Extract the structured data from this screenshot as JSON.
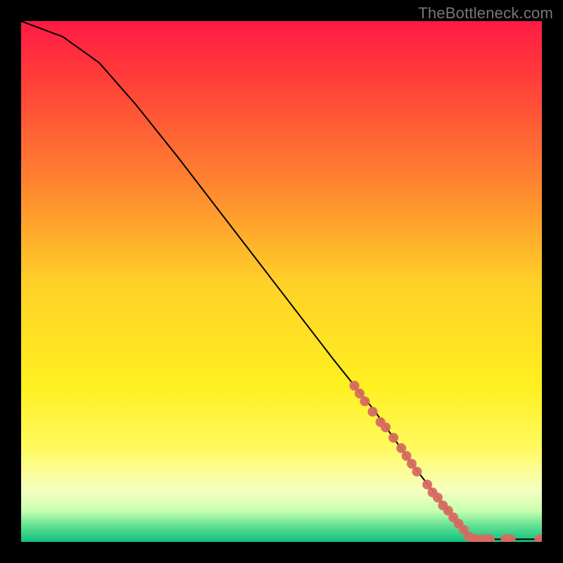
{
  "watermark": "TheBottleneck.com",
  "chart_data": {
    "type": "line",
    "title": "",
    "xlabel": "",
    "ylabel": "",
    "xlim": [
      0,
      100
    ],
    "ylim": [
      0,
      100
    ],
    "grid": false,
    "legend": false,
    "background_gradient": [
      {
        "pos": 0.0,
        "color": "#ff1a44"
      },
      {
        "pos": 0.1,
        "color": "#ff3a3a"
      },
      {
        "pos": 0.3,
        "color": "#ff8030"
      },
      {
        "pos": 0.5,
        "color": "#ffd028"
      },
      {
        "pos": 0.7,
        "color": "#fff020"
      },
      {
        "pos": 0.82,
        "color": "#fffa60"
      },
      {
        "pos": 0.9,
        "color": "#f7ffc0"
      },
      {
        "pos": 0.94,
        "color": "#c8ffb0"
      },
      {
        "pos": 0.97,
        "color": "#60e090"
      },
      {
        "pos": 1.0,
        "color": "#10c080"
      }
    ],
    "curve": [
      {
        "x": 0,
        "y": 100
      },
      {
        "x": 8,
        "y": 97
      },
      {
        "x": 15,
        "y": 92
      },
      {
        "x": 22,
        "y": 84
      },
      {
        "x": 30,
        "y": 74
      },
      {
        "x": 40,
        "y": 61
      },
      {
        "x": 50,
        "y": 48
      },
      {
        "x": 60,
        "y": 35
      },
      {
        "x": 68,
        "y": 25
      },
      {
        "x": 75,
        "y": 15
      },
      {
        "x": 82,
        "y": 6
      },
      {
        "x": 86,
        "y": 1
      },
      {
        "x": 90,
        "y": 0.5
      },
      {
        "x": 100,
        "y": 0.5
      }
    ],
    "points": [
      {
        "x": 64,
        "y": 30
      },
      {
        "x": 65,
        "y": 28.5
      },
      {
        "x": 66,
        "y": 27
      },
      {
        "x": 67.5,
        "y": 25
      },
      {
        "x": 69,
        "y": 23
      },
      {
        "x": 70,
        "y": 22
      },
      {
        "x": 71.5,
        "y": 20
      },
      {
        "x": 73,
        "y": 18
      },
      {
        "x": 74,
        "y": 16.5
      },
      {
        "x": 75,
        "y": 15
      },
      {
        "x": 76,
        "y": 13.5
      },
      {
        "x": 78,
        "y": 11
      },
      {
        "x": 79,
        "y": 9.5
      },
      {
        "x": 80,
        "y": 8.5
      },
      {
        "x": 81,
        "y": 7
      },
      {
        "x": 82,
        "y": 6
      },
      {
        "x": 83,
        "y": 4.7
      },
      {
        "x": 84,
        "y": 3.5
      },
      {
        "x": 85,
        "y": 2.3
      },
      {
        "x": 86,
        "y": 1
      },
      {
        "x": 87,
        "y": 0.6
      },
      {
        "x": 88,
        "y": 0.5
      },
      {
        "x": 89,
        "y": 0.5
      },
      {
        "x": 90,
        "y": 0.5
      },
      {
        "x": 93,
        "y": 0.5
      },
      {
        "x": 94,
        "y": 0.5
      },
      {
        "x": 99.5,
        "y": 0.5
      }
    ],
    "point_color": "#d86a62",
    "curve_color": "#000000"
  }
}
